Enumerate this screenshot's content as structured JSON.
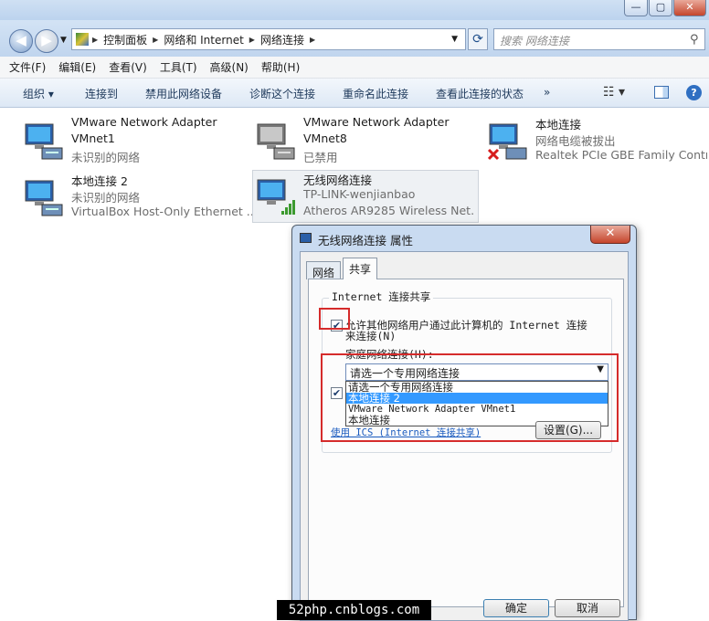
{
  "address": {
    "segments": [
      "控制面板",
      "网络和 Internet",
      "网络连接"
    ]
  },
  "search": {
    "placeholder": "搜索 网络连接"
  },
  "menu": [
    "文件(F)",
    "编辑(E)",
    "查看(V)",
    "工具(T)",
    "高级(N)",
    "帮助(H)"
  ],
  "toolbar": {
    "organize": "组织 ▾",
    "connect": "连接到",
    "disable": "禁用此网络设备",
    "diagnose": "诊断这个连接",
    "rename": "重命名此连接",
    "status": "查看此连接的状态",
    "more": "»"
  },
  "connections": [
    {
      "name": "VMware Network Adapter",
      "sub": "VMnet1",
      "status": "未识别的网络",
      "icon": "network-adapter-icon"
    },
    {
      "name": "VMware Network Adapter",
      "sub": "VMnet8",
      "status": "已禁用",
      "icon": "network-adapter-disabled-icon"
    },
    {
      "name": "本地连接",
      "sub": "网络电缆被拔出",
      "status": "Realtek PCIe GBE Family Contr...",
      "icon": "network-cable-unplugged-icon"
    },
    {
      "name": "本地连接 2",
      "sub": "未识别的网络",
      "status": "VirtualBox Host-Only Ethernet ...",
      "icon": "network-adapter-icon"
    },
    {
      "name": "无线网络连接",
      "sub": "TP-LINK-wenjianbao",
      "status": "Atheros AR9285 Wireless Net...",
      "icon": "wireless-adapter-icon"
    }
  ],
  "dialog": {
    "title": "无线网络连接 属性",
    "close": "✕",
    "tabs": [
      "网络",
      "共享"
    ],
    "group_label": "Internet 连接共享",
    "allow_line1": "允许其他网络用户通过此计算机的 Internet 连接",
    "allow_line2": "来连接(N)",
    "allow_checked": true,
    "home_label": "家庭网络连接(H):",
    "combo_value": "请选一个专用网络连接",
    "dropdown_options": [
      "请选一个专用网络连接",
      "本地连接 2",
      "VMware Network Adapter VMnet1",
      "本地连接"
    ],
    "dropdown_highlight": 1,
    "second_checked": true,
    "link": "使用 ICS (Internet 连接共享)",
    "settings": "设置(G)...",
    "ok": "确定",
    "cancel": "取消"
  },
  "watermark": "52php.cnblogs.com"
}
